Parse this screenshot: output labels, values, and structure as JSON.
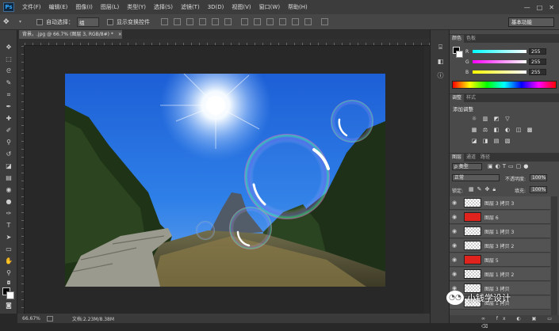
{
  "app": {
    "logo": "Ps"
  },
  "menubar": {
    "items": [
      "文件(F)",
      "编辑(E)",
      "图像(I)",
      "图层(L)",
      "类型(Y)",
      "选择(S)",
      "滤镜(T)",
      "3D(D)",
      "视图(V)",
      "窗口(W)",
      "帮助(H)"
    ],
    "window_controls": [
      "—",
      "□",
      "✕"
    ]
  },
  "options": {
    "auto_select_label": "自动选择：",
    "auto_select_value": "组",
    "show_transform_label": "显示变换控件",
    "workspace": "基本功能"
  },
  "document": {
    "tab_title": "背景。.jpg @ 66.7% (图层 3, RGB/8#) *",
    "tab_close": "×",
    "zoom": "66.67%",
    "doc_info": "文档:2.23M/8.38M"
  },
  "color_panel": {
    "tabs": [
      "颜色",
      "色板"
    ],
    "r_label": "R",
    "g_label": "G",
    "b_label": "B",
    "r_value": "255",
    "g_value": "255",
    "b_value": "255"
  },
  "adjust_panel": {
    "tabs": [
      "调整",
      "样式"
    ],
    "heading": "添加调整",
    "icons_row1": [
      "☼",
      "▥",
      "◩",
      "▽"
    ],
    "icons_row2": [
      "▦",
      "⚖",
      "◧",
      "◐",
      "◫",
      "▩"
    ],
    "icons_row3": [
      "◪",
      "◨",
      "▤",
      "▧"
    ]
  },
  "layers_panel": {
    "tabs": [
      "图层",
      "通道",
      "路径"
    ],
    "filter_kind": "ρ 类型",
    "blend_mode": "正常",
    "opacity_label": "不透明度:",
    "opacity_value": "100%",
    "lock_label": "锁定:",
    "fill_label": "填充:",
    "fill_value": "100%",
    "layers": [
      {
        "name": "图层 3 拷贝 3",
        "thumb": "checker"
      },
      {
        "name": "图层 6",
        "thumb": "red"
      },
      {
        "name": "图层 1 拷贝 3",
        "thumb": "checker"
      },
      {
        "name": "图层 3 拷贝 2",
        "thumb": "checker"
      },
      {
        "name": "图层 5",
        "thumb": "red"
      },
      {
        "name": "图层 1 拷贝 2",
        "thumb": "checker"
      },
      {
        "name": "图层 3 拷贝",
        "thumb": "checker"
      },
      {
        "name": "图层 1 拷贝",
        "thumb": "checker"
      }
    ]
  },
  "watermark": {
    "text": "小钱学设计",
    "icon": "wechat-icon"
  },
  "colors": {
    "accent": "#31a8ff",
    "red_thumb": "#e0231d"
  }
}
